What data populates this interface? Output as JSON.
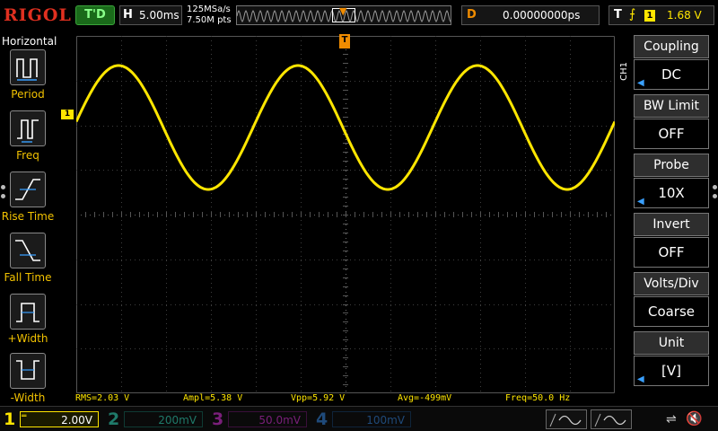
{
  "top": {
    "logo": "RIGOL",
    "run_state": "T'D",
    "horizontal_label": "H",
    "timebase": "5.00ms",
    "sample_rate": "125MSa/s",
    "memory_depth": "7.50M pts",
    "delay_label": "D",
    "delay_value": "0.00000000ps",
    "trigger_label": "T",
    "trigger_edge": "rising-edge-icon",
    "trigger_source": "1",
    "trigger_level": "1.68 V"
  },
  "left_menu": {
    "title": "Horizontal",
    "items": [
      {
        "label": "Period",
        "icon": "period-icon"
      },
      {
        "label": "Freq",
        "icon": "freq-icon"
      },
      {
        "label": "Rise Time",
        "icon": "rise-time-icon"
      },
      {
        "label": "Fall Time",
        "icon": "fall-time-icon"
      },
      {
        "label": "+Width",
        "icon": "positive-width-icon"
      },
      {
        "label": "-Width",
        "icon": "negative-width-icon"
      }
    ]
  },
  "screen": {
    "ch1_marker": "1",
    "trigger_marker": "T",
    "waveform_color": "#ffe600"
  },
  "measurements": {
    "rms": "RMS=2.03 V",
    "ampl": "Ampl=5.38 V",
    "vpp": "Vpp=5.92 V",
    "avg": "Avg=-499mV",
    "freq": "Freq=50.0 Hz"
  },
  "right_menu": {
    "channel_tag": "CH1",
    "items": [
      {
        "title": "Coupling",
        "value": "DC"
      },
      {
        "title": "BW Limit",
        "value": "OFF"
      },
      {
        "title": "Probe",
        "value": "10X"
      },
      {
        "title": "Invert",
        "value": "OFF"
      },
      {
        "title": "Volts/Div",
        "value": "Coarse"
      },
      {
        "title": "Unit",
        "value": "[V]"
      }
    ]
  },
  "channels": [
    {
      "num": "1",
      "scale": "2.00V"
    },
    {
      "num": "2",
      "scale": "200mV"
    },
    {
      "num": "3",
      "scale": "50.0mV"
    },
    {
      "num": "4",
      "scale": "100mV"
    }
  ],
  "colors": {
    "ch1": "#ffe600",
    "ch2": "#1f7a6a",
    "ch3": "#7a1f7a",
    "ch4": "#1f4a7a",
    "trigger": "#f08c00",
    "logo": "#e03020"
  }
}
